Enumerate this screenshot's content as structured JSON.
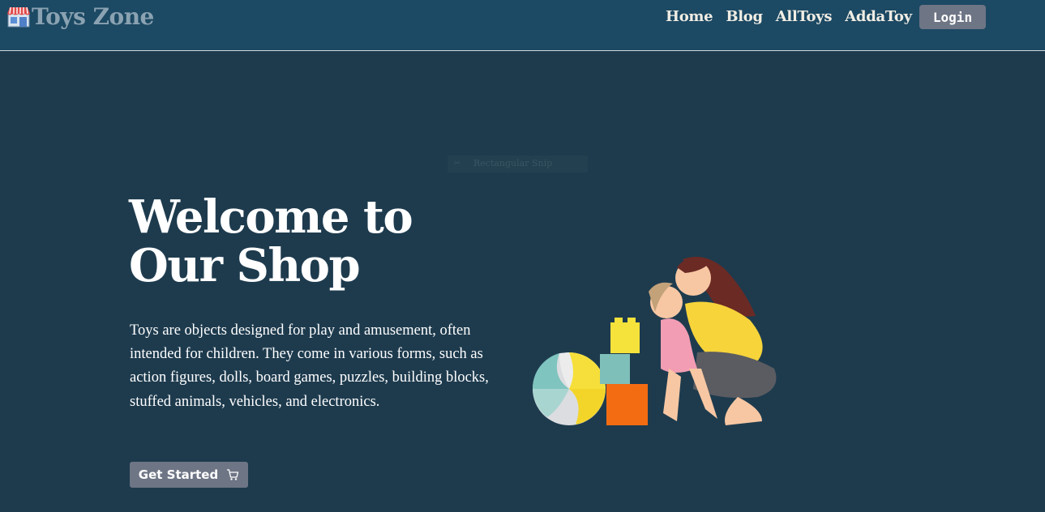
{
  "header": {
    "brand_name": "Toys Zone",
    "brand_icon": "store-icon",
    "nav": [
      {
        "label": "Home"
      },
      {
        "label": "Blog"
      },
      {
        "label": "AllToys"
      },
      {
        "label": "AddaToy"
      }
    ],
    "login_label": "Login"
  },
  "overlay": {
    "text": "Rectangular Snip"
  },
  "hero": {
    "title": "Welcome to Our Shop",
    "description": "Toys are objects designed for play and amusement, often intended for children. They come in various forms, such as action figures, dolls, board games, puzzles, building blocks, stuffed animals, vehicles, and electronics.",
    "cta_label": "Get Started",
    "cta_icon": "cart-icon",
    "illustration": "mother-child-toys-illustration"
  },
  "colors": {
    "navbar_bg": "#1c4963",
    "page_bg": "#1e3b4e",
    "button_bg": "#6e7585",
    "brand_text": "#8aa2b2"
  }
}
